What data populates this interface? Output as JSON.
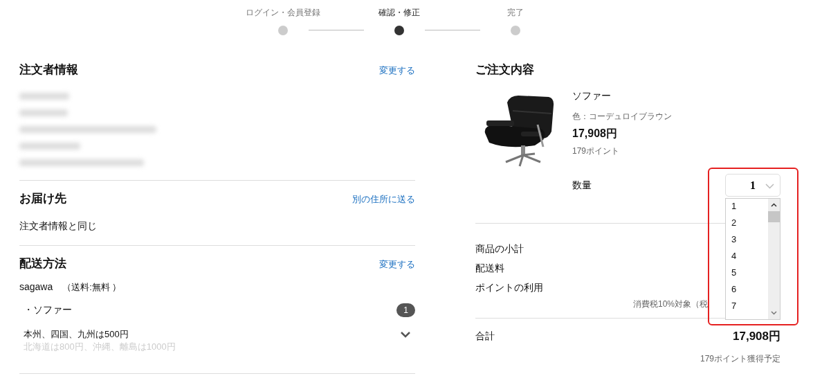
{
  "steps": [
    {
      "label": "ログイン・会員登録",
      "selected": false
    },
    {
      "label": "確認・修正",
      "selected": true
    },
    {
      "label": "完了",
      "selected": false
    }
  ],
  "orderer": {
    "title": "注文者情報",
    "action": "変更する"
  },
  "delivery": {
    "title": "お届け先",
    "action": "別の住所に送る",
    "address": "注文者情報と同じ"
  },
  "shipping": {
    "title": "配送方法",
    "action": "変更する",
    "carrier": "sagawa",
    "fee": "（送料:無料 ）",
    "items": [
      {
        "name": "・ソファー",
        "count": "1"
      }
    ],
    "note": "本州、四国、九州は500円",
    "note_more": "北海道は800円、沖縄、離島は1000円"
  },
  "order": {
    "title": "ご注文内容",
    "product": {
      "name": "ソファー",
      "variant": "色：コーデュロイブラウン",
      "price": "17,908円",
      "points": "179ポイント",
      "qty_label": "数量",
      "qty": "1",
      "options": [
        "1",
        "2",
        "3",
        "4",
        "5",
        "6",
        "7"
      ]
    },
    "summary": [
      "商品の小計",
      "配送料",
      "ポイントの利用"
    ],
    "tax_note": "消費税10%対象（税",
    "total_label": "合計",
    "total": "17,908円",
    "points_note": "179ポイント獲得予定"
  }
}
